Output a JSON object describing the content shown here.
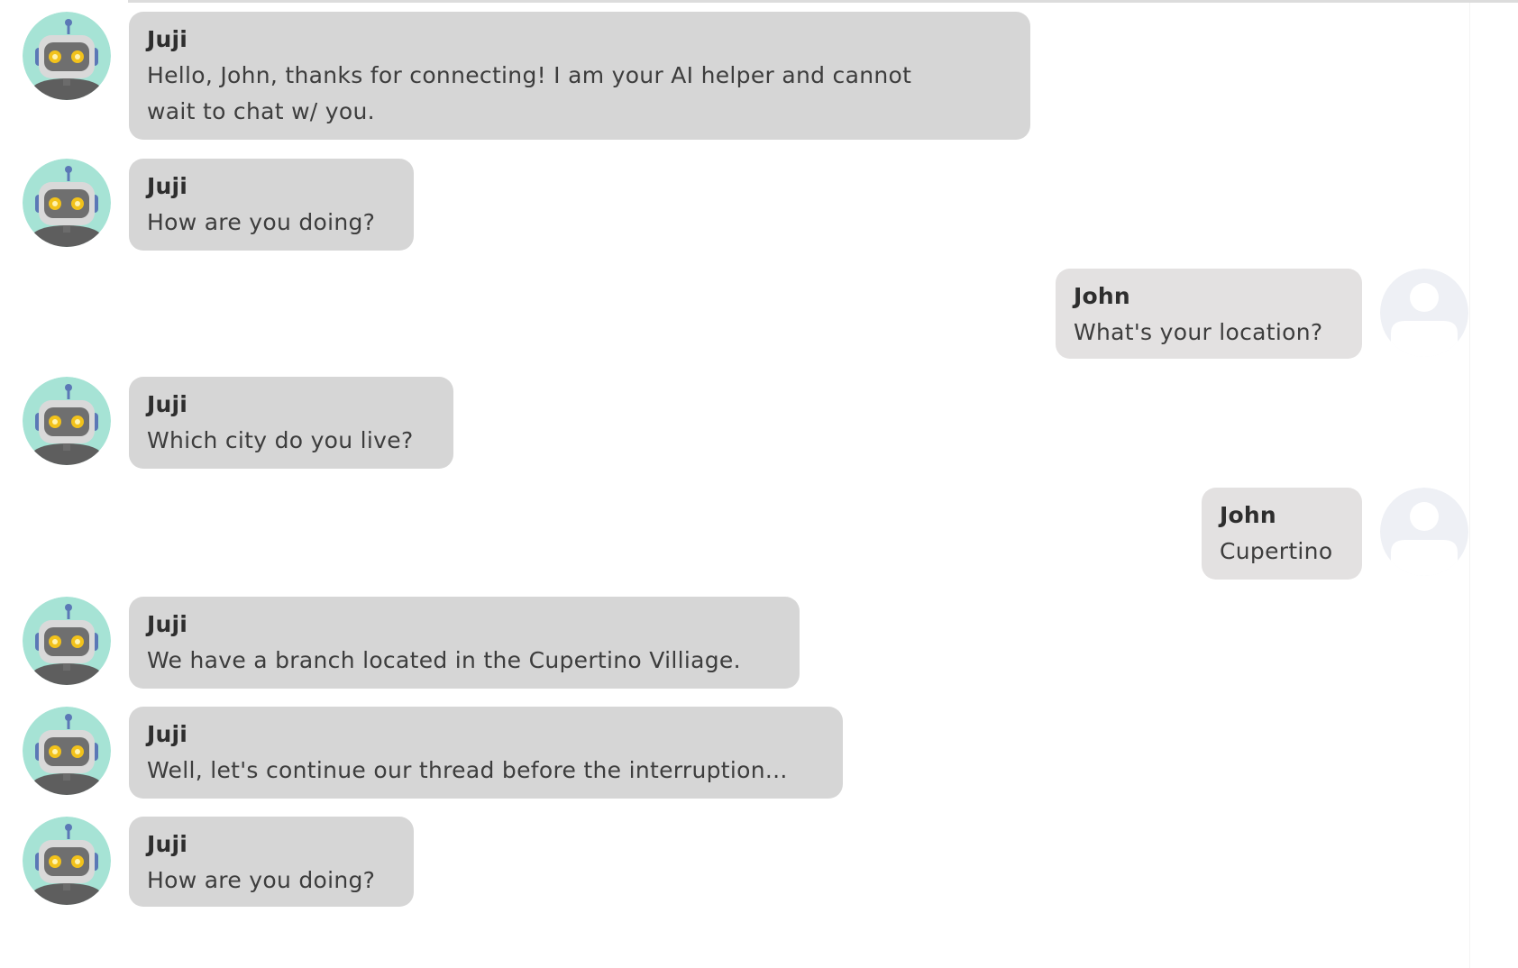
{
  "conversation": {
    "messages": [
      {
        "sender": "bot",
        "name": "Juji",
        "text": "Hello, John, thanks for connecting! I am your AI helper and cannot\nwait to chat w/ you."
      },
      {
        "sender": "bot",
        "name": "Juji",
        "text": "How are you doing?"
      },
      {
        "sender": "user",
        "name": "John",
        "text": "What's your location?"
      },
      {
        "sender": "bot",
        "name": "Juji",
        "text": "Which city do you live?"
      },
      {
        "sender": "user",
        "name": "John",
        "text": "Cupertino"
      },
      {
        "sender": "bot",
        "name": "Juji",
        "text": "We have a branch located in the Cupertino Villiage."
      },
      {
        "sender": "bot",
        "name": "Juji",
        "text": "Well, let's continue our thread before the interruption..."
      },
      {
        "sender": "bot",
        "name": "Juji",
        "text": "How are you doing?"
      }
    ]
  },
  "icons": {
    "bot_avatar": "robot-avatar-icon",
    "user_avatar": "user-avatar-icon"
  },
  "colors": {
    "bot_bubble": "#d6d6d6",
    "user_bubble": "#e3e1e1",
    "bot_avatar_bg": "#a6e3d5",
    "robot_eye": "#f2c21b"
  }
}
